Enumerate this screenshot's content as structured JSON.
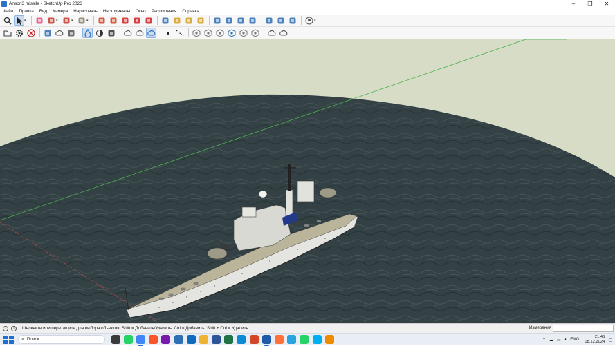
{
  "window": {
    "title": "Anson3 missile - SketchUp Pro 2023",
    "minimize_glyph": "–",
    "maximize_glyph": "❐",
    "close_glyph": "✕"
  },
  "menu": [
    "Файл",
    "Правка",
    "Вид",
    "Камера",
    "Нарисовать",
    "Инструменты",
    "Окно",
    "Расширения",
    "Справка"
  ],
  "toolbar1": [
    {
      "icon": "magnifier-icon",
      "color": "#333333"
    },
    {
      "icon": "select-arrow-icon",
      "color": "#222222",
      "active": true,
      "dropdown": true
    },
    {
      "icon": "eraser-icon",
      "color": "#e0507a"
    },
    {
      "icon": "pencil-line-icon",
      "color": "#c0392b",
      "dropdown": true
    },
    {
      "icon": "arc-icon",
      "color": "#c0392b",
      "dropdown": true
    },
    {
      "icon": "shape-circle-icon",
      "color": "#8a7f6a",
      "dropdown": true
    },
    {
      "icon": "push-pull-icon",
      "color": "#d04020"
    },
    {
      "icon": "follow-me-icon",
      "color": "#d04020"
    },
    {
      "icon": "move-icon",
      "color": "#d02020"
    },
    {
      "icon": "rotate-icon",
      "color": "#d02020"
    },
    {
      "icon": "scale-icon",
      "color": "#d02020"
    },
    {
      "icon": "offset-icon",
      "color": "#2f6fb3"
    },
    {
      "icon": "tape-measure-icon",
      "color": "#d4a020"
    },
    {
      "icon": "paint-bucket-icon",
      "color": "#d4a020"
    },
    {
      "icon": "text-icon",
      "color": "#d4a020"
    },
    {
      "icon": "orbit-icon",
      "color": "#2f6fb3"
    },
    {
      "icon": "pan-icon",
      "color": "#2f6fb3"
    },
    {
      "icon": "zoom-icon",
      "color": "#2f6fb3"
    },
    {
      "icon": "zoom-extents-icon",
      "color": "#2f6fb3"
    },
    {
      "icon": "warehouse-icon",
      "color": "#2f6fb3"
    },
    {
      "icon": "extension-warehouse-icon",
      "color": "#2f6fb3"
    },
    {
      "icon": "layout-icon",
      "color": "#2f6fb3"
    },
    {
      "icon": "account-icon",
      "color": "#555555",
      "dropdown": true
    }
  ],
  "toolbar2": [
    {
      "icon": "folder-icon",
      "color": "#444444"
    },
    {
      "icon": "gear-icon",
      "color": "#333333"
    },
    {
      "icon": "stop-icon",
      "color": "#d02020"
    },
    {
      "icon": "solid-tools-icon",
      "color": "#2f6fb3"
    },
    {
      "icon": "cloud-tools-icon",
      "color": "#555555"
    },
    {
      "icon": "sandbox-icon",
      "color": "#555555"
    },
    {
      "icon": "drop-icon",
      "color": "#2f6fb3",
      "active": true
    },
    {
      "icon": "half-circle-icon",
      "color": "#333333"
    },
    {
      "icon": "styles-icon",
      "color": "#333333"
    },
    {
      "icon": "cloud-upload-icon",
      "color": "#555555"
    },
    {
      "icon": "cloud-download-icon",
      "color": "#555555"
    },
    {
      "icon": "cloud-sync-icon",
      "color": "#2f6fb3",
      "active": true
    },
    {
      "icon": "dot-icon",
      "color": "#222222"
    },
    {
      "icon": "dotted-line-icon",
      "color": "#222222"
    },
    {
      "icon": "view-iso-icon",
      "color": "#777777"
    },
    {
      "icon": "view-top-icon",
      "color": "#777777"
    },
    {
      "icon": "view-front-icon",
      "color": "#777777"
    },
    {
      "icon": "view-right-icon",
      "color": "#2f6fb3"
    },
    {
      "icon": "view-back-icon",
      "color": "#777777"
    },
    {
      "icon": "view-left-icon",
      "color": "#777777"
    },
    {
      "icon": "cloud-share-icon",
      "color": "#555555"
    },
    {
      "icon": "cloud-refresh-icon",
      "color": "#555555"
    }
  ],
  "colors": {
    "sky": "#d6dcc6",
    "sea": "#364549",
    "sea_edge": "#2b3538",
    "axis_green": "#4caf50",
    "axis_red": "#b44",
    "hull": "#e4e4e0",
    "deck": "#bab59a"
  },
  "status": {
    "hint": "Щелкните или перетащите для выбора объектов. Shift = Добавить/Удалить. Ctrl = Добавить. Shift + Ctrl = Удалить.",
    "measurements_label": "Измерения",
    "measurements_value": ""
  },
  "taskbar": {
    "search_placeholder": "Поиск",
    "apps": [
      {
        "icon": "task-view-icon",
        "color": "#3a3a3a"
      },
      {
        "icon": "whatsapp-icon",
        "color": "#25d366"
      },
      {
        "icon": "chrome-icon",
        "color": "#4285f4",
        "running": true
      },
      {
        "icon": "brave-icon",
        "color": "#fb542b"
      },
      {
        "icon": "onenote-icon",
        "color": "#7719aa"
      },
      {
        "icon": "photos-icon",
        "color": "#2f6fb3"
      },
      {
        "icon": "outlook-icon",
        "color": "#0f6cbd"
      },
      {
        "icon": "file-explorer-icon",
        "color": "#f0b232"
      },
      {
        "icon": "word-icon",
        "color": "#2b579a"
      },
      {
        "icon": "excel-icon",
        "color": "#217346"
      },
      {
        "icon": "edge-icon",
        "color": "#0c8ad6"
      },
      {
        "icon": "powerpoint-icon",
        "color": "#d24726"
      },
      {
        "icon": "sketchup-icon",
        "color": "#1f5aa8",
        "running": true
      },
      {
        "icon": "firefox-icon",
        "color": "#ff7139"
      },
      {
        "icon": "telegram-icon",
        "color": "#2aa4e0"
      },
      {
        "icon": "whatsapp-icon",
        "color": "#25d366"
      },
      {
        "icon": "skype-icon",
        "color": "#00aff0"
      },
      {
        "icon": "vlc-icon",
        "color": "#f08a00"
      }
    ],
    "lang": "ENG",
    "time": "21:45",
    "date": "08.12.2024"
  }
}
